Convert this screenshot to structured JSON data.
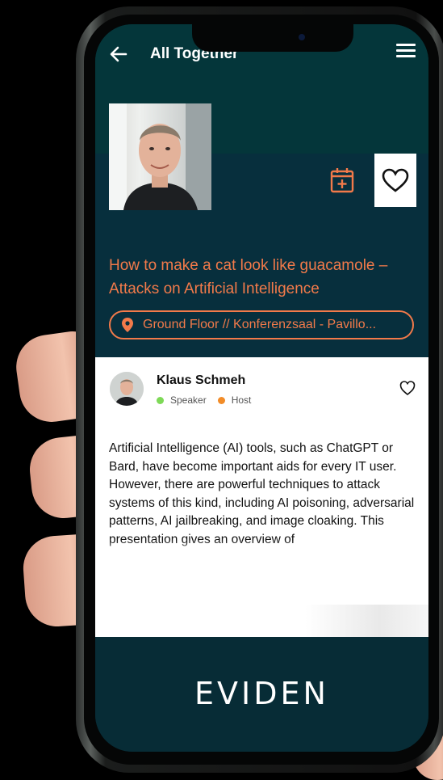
{
  "app": {
    "title": "All Together"
  },
  "session": {
    "title": "How to make a cat look like guacamole – Attacks on Artificial Intelligence",
    "location": "Ground Floor // Konferenzsaal - Pavillo...",
    "description": "Artificial Intelligence (AI) tools, such as ChatGPT or Bard, have become important aids for every IT user. However, there are powerful techniques to attack systems of this kind, including AI poisoning, adversarial patterns, AI jailbreaking, and image cloaking. This presentation gives an overview of"
  },
  "speaker": {
    "name": "Klaus Schmeh",
    "roles": [
      {
        "label": "Speaker",
        "color": "#7ed957"
      },
      {
        "label": "Host",
        "color": "#f28c28"
      }
    ]
  },
  "footer": {
    "brand": "EVIDEN"
  },
  "colors": {
    "accent": "#f27a4a",
    "header": "#04363a",
    "background": "#072f3d"
  },
  "icons": [
    "back-arrow-icon",
    "hamburger-menu-icon",
    "calendar-add-icon",
    "heart-icon",
    "location-pin-icon"
  ]
}
